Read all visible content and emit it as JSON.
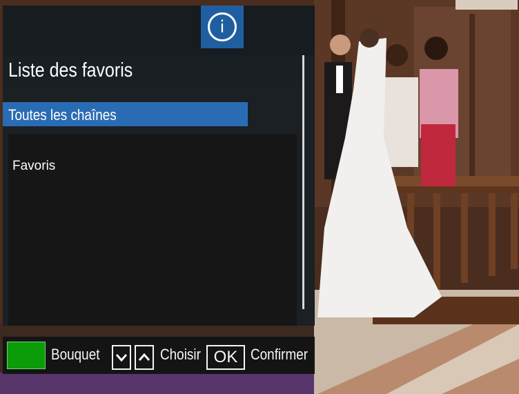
{
  "panel": {
    "info_icon_glyph": "i",
    "title": "Liste des favoris",
    "selected_item": "Toutes les chaînes",
    "list_items": [
      "Favoris"
    ]
  },
  "footer": {
    "bouquet_label": "Bouquet",
    "choisir_label": "Choisir",
    "ok_key_label": "OK",
    "confirmer_label": "Confirmer",
    "green_key_color": "#0aa10a"
  },
  "colors": {
    "highlight": "#2a6cb3",
    "info_button": "#1f5f9f",
    "panel_bg": "#1b2024"
  },
  "icons": {
    "info": "info-icon",
    "down": "chevron-down-icon",
    "up": "chevron-up-icon"
  }
}
